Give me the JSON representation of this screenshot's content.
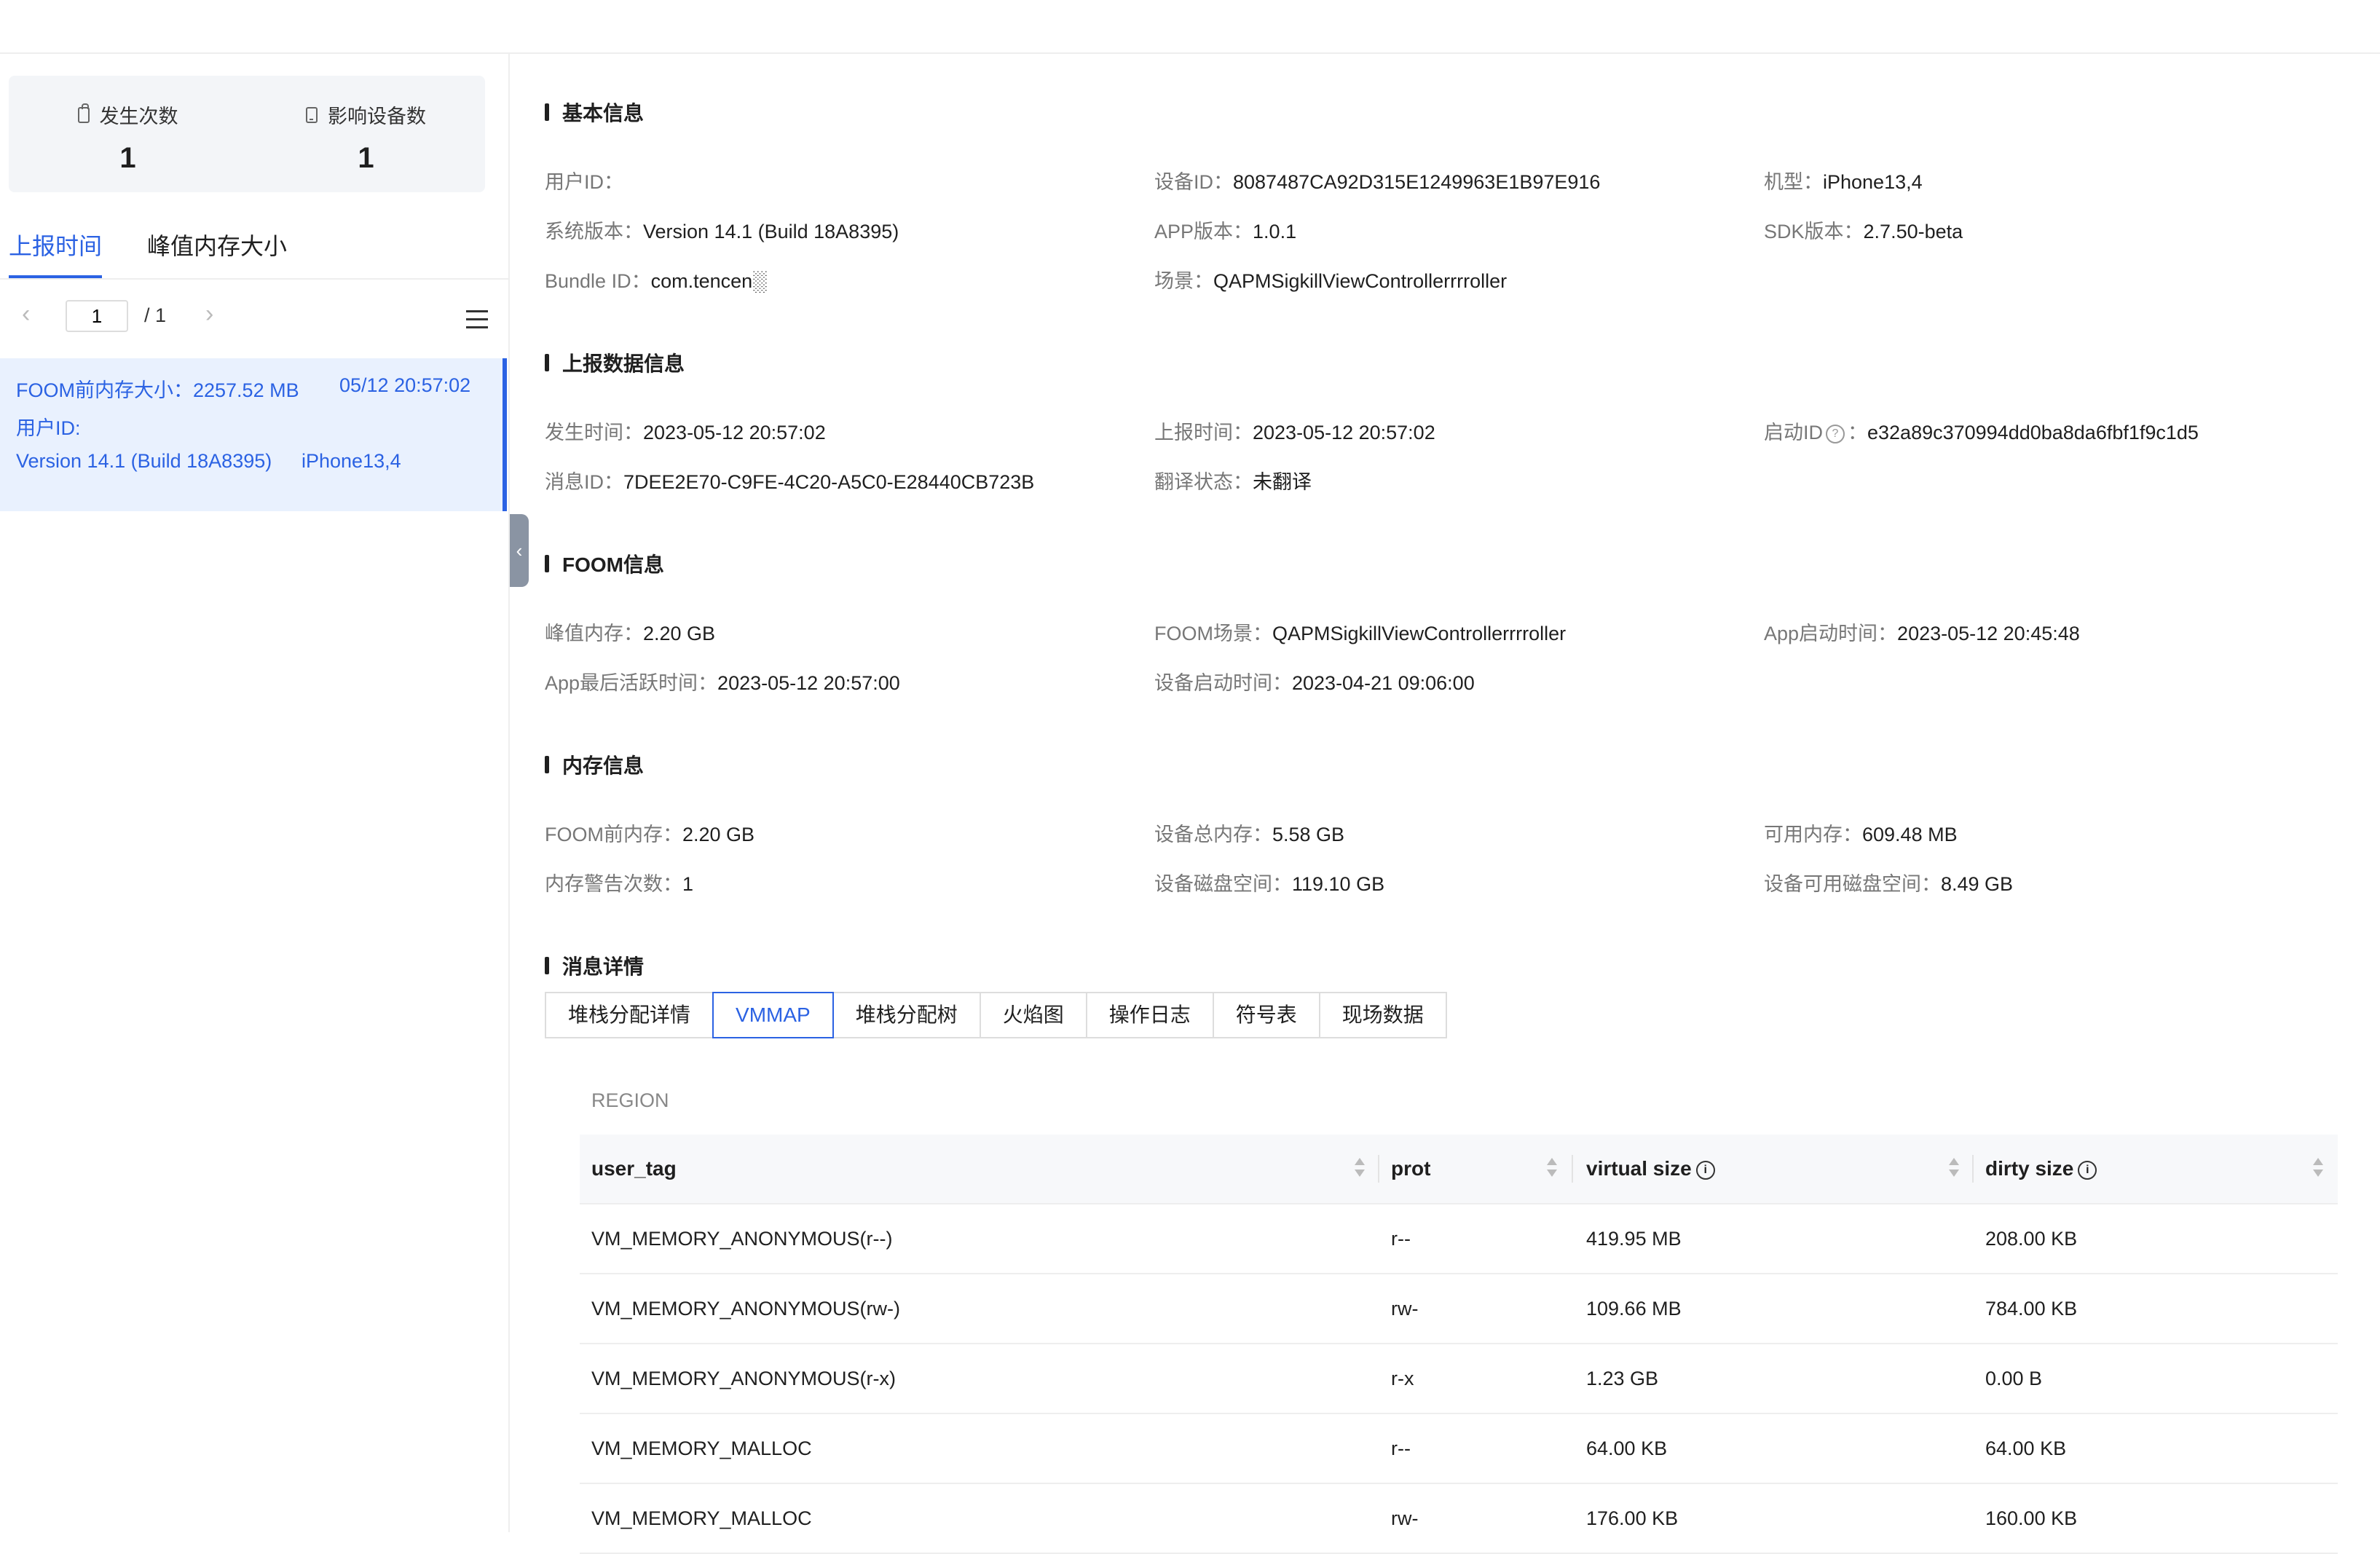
{
  "stats": {
    "occurrences_label": "发生次数",
    "occurrences_value": "1",
    "devices_label": "影响设备数",
    "devices_value": "1"
  },
  "left_tabs": [
    "上报时间",
    "峰值内存大小"
  ],
  "pager": {
    "current": "1",
    "total": "/ 1"
  },
  "record": {
    "mem_before": "FOOM前内存大小：2257.52 MB",
    "time": "05/12 20:57:02",
    "user_id": "用户ID:",
    "version": "Version 14.1 (Build 18A8395)",
    "model": "iPhone13,4"
  },
  "sections": {
    "basic": {
      "title": "基本信息",
      "user_id_label": "用户ID：",
      "user_id_value": "",
      "device_id_label": "设备ID：",
      "device_id_value": "8087487CA92D315E1249963E1B97E916",
      "model_label": "机型：",
      "model_value": "iPhone13,4",
      "os_label": "系统版本：",
      "os_value": "Version 14.1 (Build 18A8395)",
      "app_ver_label": "APP版本：",
      "app_ver_value": "1.0.1",
      "sdk_label": "SDK版本：",
      "sdk_value": "2.7.50-beta",
      "bundle_label": "Bundle ID：",
      "bundle_value": "com.tencen░",
      "scene_label": "场景：",
      "scene_value": "QAPMSigkillViewControllerrrroller"
    },
    "report": {
      "title": "上报数据信息",
      "occur_label": "发生时间：",
      "occur_value": "2023-05-12 20:57:02",
      "report_label": "上报时间：",
      "report_value": "2023-05-12 20:57:02",
      "launch_label": "启动ID",
      "launch_value": "e32a89c370994dd0ba8da6fbf1f9c1d5",
      "msg_label": "消息ID：",
      "msg_value": "7DEE2E70-C9FE-4C20-A5C0-E28440CB723B",
      "trans_label": "翻译状态：",
      "trans_value": "未翻译"
    },
    "foom": {
      "title": "FOOM信息",
      "peak_label": "峰值内存：",
      "peak_value": "2.20 GB",
      "scene_label": "FOOM场景：",
      "scene_value": "QAPMSigkillViewControllerrrroller",
      "launch_label": "App启动时间：",
      "launch_value": "2023-05-12 20:45:48",
      "active_label": "App最后活跃时间：",
      "active_value": "2023-05-12 20:57:00",
      "boot_label": "设备启动时间：",
      "boot_value": "2023-04-21 09:06:00"
    },
    "memory": {
      "title": "内存信息",
      "before_label": "FOOM前内存：",
      "before_value": "2.20 GB",
      "total_label": "设备总内存：",
      "total_value": "5.58 GB",
      "avail_label": "可用内存：",
      "avail_value": "609.48 MB",
      "warn_label": "内存警告次数：",
      "warn_value": "1",
      "disk_label": "设备磁盘空间：",
      "disk_value": "119.10 GB",
      "disk_avail_label": "设备可用磁盘空间：",
      "disk_avail_value": "8.49 GB"
    },
    "detail": {
      "title": "消息详情"
    }
  },
  "detail_tabs": [
    "堆栈分配详情",
    "VMMAP",
    "堆栈分配树",
    "火焰图",
    "操作日志",
    "符号表",
    "现场数据"
  ],
  "region_label": "REGION",
  "table": {
    "columns": [
      "user_tag",
      "prot",
      "virtual size",
      "dirty size"
    ],
    "rows": [
      [
        "VM_MEMORY_ANONYMOUS(r--)",
        "r--",
        "419.95 MB",
        "208.00 KB"
      ],
      [
        "VM_MEMORY_ANONYMOUS(rw-)",
        "rw-",
        "109.66 MB",
        "784.00 KB"
      ],
      [
        "VM_MEMORY_ANONYMOUS(r-x)",
        "r-x",
        "1.23 GB",
        "0.00 B"
      ],
      [
        "VM_MEMORY_MALLOC",
        "r--",
        "64.00 KB",
        "64.00 KB"
      ],
      [
        "VM_MEMORY_MALLOC",
        "rw-",
        "176.00 KB",
        "160.00 KB"
      ]
    ]
  },
  "colors": {
    "accent": "#2b62e3",
    "selected_bg": "#e9f1fe",
    "stats_bg": "#f3f5f8"
  },
  "icons": [
    "bag-icon",
    "phone-icon",
    "chevron-left-icon",
    "chevron-right-icon",
    "menu-icon",
    "help-circle-icon",
    "info-circle-icon",
    "sort-icon"
  ]
}
